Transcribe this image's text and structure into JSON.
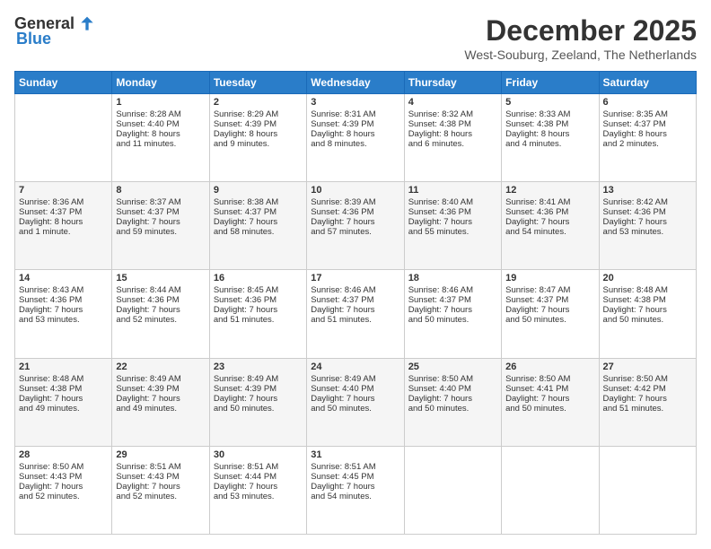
{
  "logo": {
    "general": "General",
    "blue": "Blue"
  },
  "title": "December 2025",
  "subtitle": "West-Souburg, Zeeland, The Netherlands",
  "headers": [
    "Sunday",
    "Monday",
    "Tuesday",
    "Wednesday",
    "Thursday",
    "Friday",
    "Saturday"
  ],
  "weeks": [
    [
      {
        "day": "",
        "content": ""
      },
      {
        "day": "1",
        "content": "Sunrise: 8:28 AM\nSunset: 4:40 PM\nDaylight: 8 hours\nand 11 minutes."
      },
      {
        "day": "2",
        "content": "Sunrise: 8:29 AM\nSunset: 4:39 PM\nDaylight: 8 hours\nand 9 minutes."
      },
      {
        "day": "3",
        "content": "Sunrise: 8:31 AM\nSunset: 4:39 PM\nDaylight: 8 hours\nand 8 minutes."
      },
      {
        "day": "4",
        "content": "Sunrise: 8:32 AM\nSunset: 4:38 PM\nDaylight: 8 hours\nand 6 minutes."
      },
      {
        "day": "5",
        "content": "Sunrise: 8:33 AM\nSunset: 4:38 PM\nDaylight: 8 hours\nand 4 minutes."
      },
      {
        "day": "6",
        "content": "Sunrise: 8:35 AM\nSunset: 4:37 PM\nDaylight: 8 hours\nand 2 minutes."
      }
    ],
    [
      {
        "day": "7",
        "content": "Sunrise: 8:36 AM\nSunset: 4:37 PM\nDaylight: 8 hours\nand 1 minute."
      },
      {
        "day": "8",
        "content": "Sunrise: 8:37 AM\nSunset: 4:37 PM\nDaylight: 7 hours\nand 59 minutes."
      },
      {
        "day": "9",
        "content": "Sunrise: 8:38 AM\nSunset: 4:37 PM\nDaylight: 7 hours\nand 58 minutes."
      },
      {
        "day": "10",
        "content": "Sunrise: 8:39 AM\nSunset: 4:36 PM\nDaylight: 7 hours\nand 57 minutes."
      },
      {
        "day": "11",
        "content": "Sunrise: 8:40 AM\nSunset: 4:36 PM\nDaylight: 7 hours\nand 55 minutes."
      },
      {
        "day": "12",
        "content": "Sunrise: 8:41 AM\nSunset: 4:36 PM\nDaylight: 7 hours\nand 54 minutes."
      },
      {
        "day": "13",
        "content": "Sunrise: 8:42 AM\nSunset: 4:36 PM\nDaylight: 7 hours\nand 53 minutes."
      }
    ],
    [
      {
        "day": "14",
        "content": "Sunrise: 8:43 AM\nSunset: 4:36 PM\nDaylight: 7 hours\nand 53 minutes."
      },
      {
        "day": "15",
        "content": "Sunrise: 8:44 AM\nSunset: 4:36 PM\nDaylight: 7 hours\nand 52 minutes."
      },
      {
        "day": "16",
        "content": "Sunrise: 8:45 AM\nSunset: 4:36 PM\nDaylight: 7 hours\nand 51 minutes."
      },
      {
        "day": "17",
        "content": "Sunrise: 8:46 AM\nSunset: 4:37 PM\nDaylight: 7 hours\nand 51 minutes."
      },
      {
        "day": "18",
        "content": "Sunrise: 8:46 AM\nSunset: 4:37 PM\nDaylight: 7 hours\nand 50 minutes."
      },
      {
        "day": "19",
        "content": "Sunrise: 8:47 AM\nSunset: 4:37 PM\nDaylight: 7 hours\nand 50 minutes."
      },
      {
        "day": "20",
        "content": "Sunrise: 8:48 AM\nSunset: 4:38 PM\nDaylight: 7 hours\nand 50 minutes."
      }
    ],
    [
      {
        "day": "21",
        "content": "Sunrise: 8:48 AM\nSunset: 4:38 PM\nDaylight: 7 hours\nand 49 minutes."
      },
      {
        "day": "22",
        "content": "Sunrise: 8:49 AM\nSunset: 4:39 PM\nDaylight: 7 hours\nand 49 minutes."
      },
      {
        "day": "23",
        "content": "Sunrise: 8:49 AM\nSunset: 4:39 PM\nDaylight: 7 hours\nand 50 minutes."
      },
      {
        "day": "24",
        "content": "Sunrise: 8:49 AM\nSunset: 4:40 PM\nDaylight: 7 hours\nand 50 minutes."
      },
      {
        "day": "25",
        "content": "Sunrise: 8:50 AM\nSunset: 4:40 PM\nDaylight: 7 hours\nand 50 minutes."
      },
      {
        "day": "26",
        "content": "Sunrise: 8:50 AM\nSunset: 4:41 PM\nDaylight: 7 hours\nand 50 minutes."
      },
      {
        "day": "27",
        "content": "Sunrise: 8:50 AM\nSunset: 4:42 PM\nDaylight: 7 hours\nand 51 minutes."
      }
    ],
    [
      {
        "day": "28",
        "content": "Sunrise: 8:50 AM\nSunset: 4:43 PM\nDaylight: 7 hours\nand 52 minutes."
      },
      {
        "day": "29",
        "content": "Sunrise: 8:51 AM\nSunset: 4:43 PM\nDaylight: 7 hours\nand 52 minutes."
      },
      {
        "day": "30",
        "content": "Sunrise: 8:51 AM\nSunset: 4:44 PM\nDaylight: 7 hours\nand 53 minutes."
      },
      {
        "day": "31",
        "content": "Sunrise: 8:51 AM\nSunset: 4:45 PM\nDaylight: 7 hours\nand 54 minutes."
      },
      {
        "day": "",
        "content": ""
      },
      {
        "day": "",
        "content": ""
      },
      {
        "day": "",
        "content": ""
      }
    ]
  ]
}
